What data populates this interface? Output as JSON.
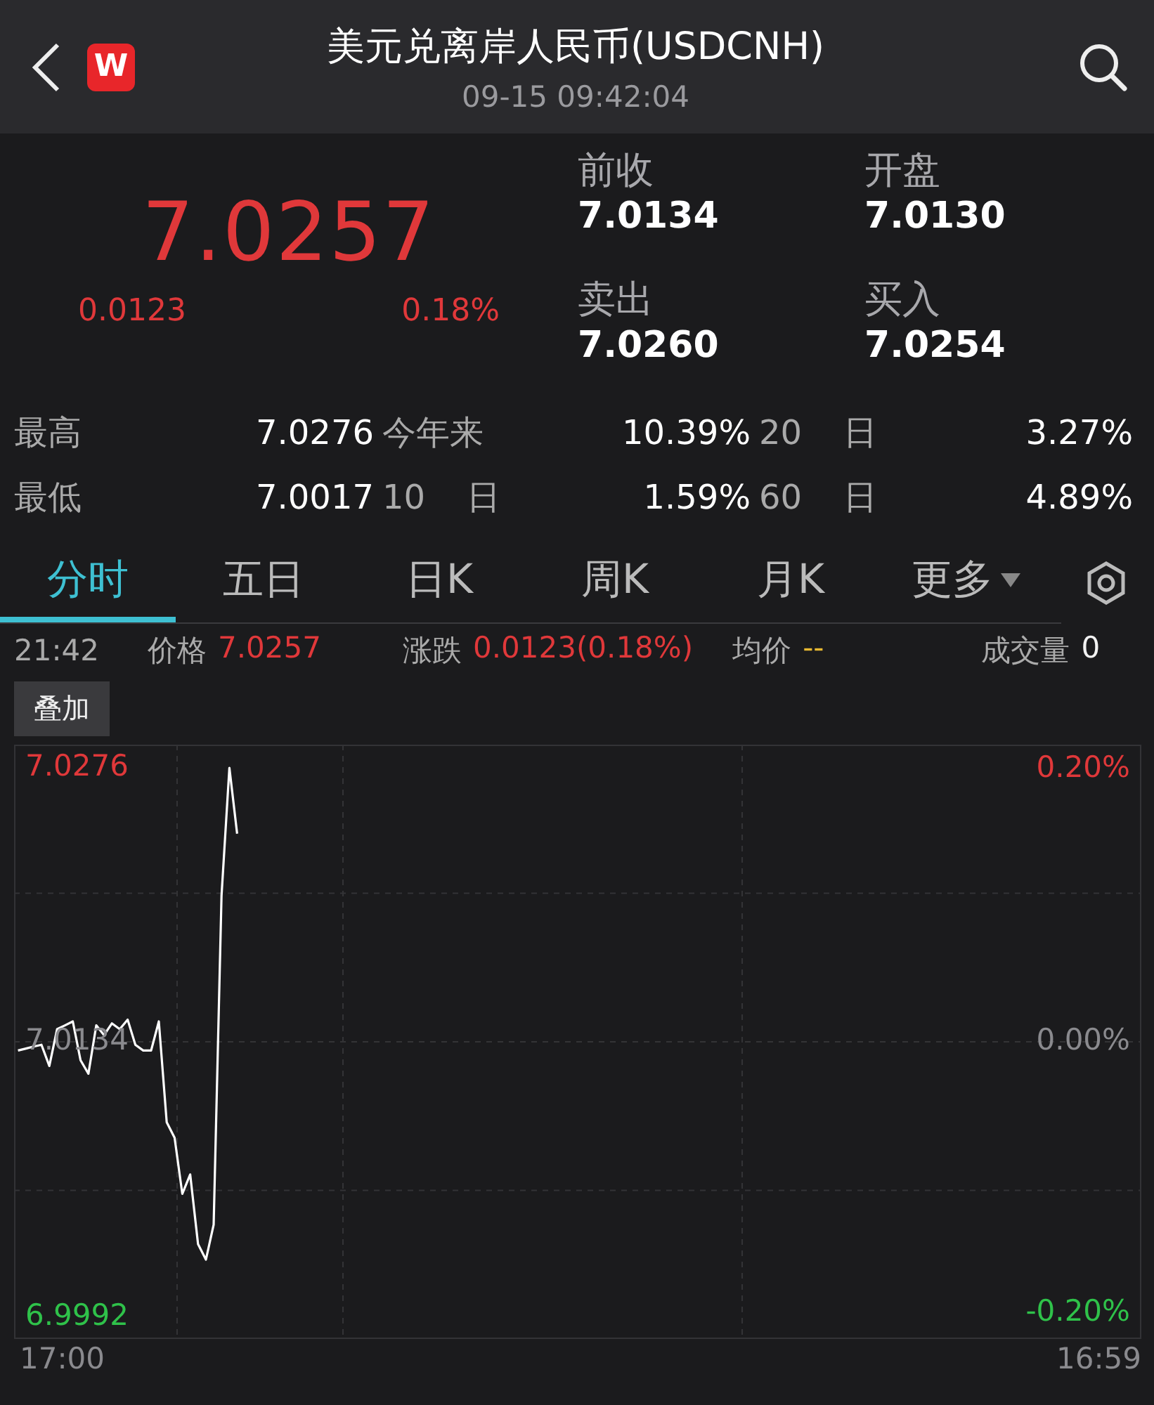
{
  "header": {
    "logo": "W",
    "title": "美元兑离岸人民币(USDCNH)",
    "time": "09-15 09:42:04"
  },
  "quote": {
    "price": "7.0257",
    "change": "0.0123",
    "change_pct": "0.18%",
    "color": "#e0383a",
    "fields": [
      {
        "label": "前收",
        "value": "7.0134"
      },
      {
        "label": "开盘",
        "value": "7.0130"
      },
      {
        "label": "卖出",
        "value": "7.0260"
      },
      {
        "label": "买入",
        "value": "7.0254"
      }
    ]
  },
  "stats": [
    [
      {
        "label": "最高",
        "value": "7.0276"
      },
      {
        "label": "今年来",
        "value": "10.39%"
      },
      {
        "label": "20 日",
        "value": "3.27%"
      }
    ],
    [
      {
        "label": "最低",
        "value": "7.0017"
      },
      {
        "label": "10 日",
        "value": "1.59%"
      },
      {
        "label": "60 日",
        "value": "4.89%"
      }
    ]
  ],
  "tabs": [
    {
      "label": "分时",
      "selected": true,
      "dropdown": false
    },
    {
      "label": "五日",
      "selected": false,
      "dropdown": false
    },
    {
      "label": "日K",
      "selected": false,
      "dropdown": false
    },
    {
      "label": "周K",
      "selected": false,
      "dropdown": false
    },
    {
      "label": "月K",
      "selected": false,
      "dropdown": false
    },
    {
      "label": "更多",
      "selected": false,
      "dropdown": true
    }
  ],
  "info": {
    "time": "21:42",
    "items": [
      {
        "label": "价格",
        "value": "7.0257",
        "color": "#e0383a"
      },
      {
        "label": "涨跌",
        "value": "0.0123(0.18%)",
        "color": "#e0383a"
      },
      {
        "label": "均价",
        "value": "--",
        "color": "#e8b931"
      },
      {
        "label": "成交量",
        "value": "0",
        "color": "#f2f2f2"
      }
    ]
  },
  "overlay_button": "叠加",
  "percent_axis": [
    "0.20%",
    "0.00%",
    "-0.20%"
  ],
  "time_axis": [
    "17:00",
    "16:59"
  ],
  "chart_data": {
    "type": "line",
    "ylim": [
      6.9981,
      7.0288
    ],
    "yticks": [
      {
        "value": 7.0276,
        "label": "7.0276"
      },
      {
        "value": 7.0134,
        "label": "7.0134"
      },
      {
        "value": 6.9992,
        "label": "6.9992"
      }
    ],
    "categories": [
      null,
      null,
      null,
      null,
      null,
      null,
      null,
      null,
      null,
      null,
      null,
      null,
      null,
      null,
      null,
      null,
      null,
      null,
      null,
      null,
      null,
      null,
      null,
      null,
      null,
      null,
      null,
      null,
      null,
      null,
      null,
      null,
      null,
      null,
      null,
      null,
      null,
      null,
      null,
      null,
      null,
      null,
      null,
      null,
      null,
      null,
      null,
      null,
      null,
      null,
      null,
      null,
      null,
      null,
      null,
      null,
      null,
      null,
      null,
      null,
      null,
      null,
      null,
      null,
      null,
      null,
      null,
      null,
      null,
      null,
      null,
      null,
      null,
      null,
      null,
      null,
      null,
      null,
      null,
      null,
      null,
      null,
      null,
      null,
      null,
      null,
      null,
      null,
      null,
      null,
      null,
      null,
      null,
      null,
      null,
      null,
      null,
      null,
      null,
      null,
      null,
      null,
      null,
      null,
      null,
      null,
      null,
      null,
      null,
      null,
      null,
      null,
      null,
      null,
      null,
      null,
      null,
      null,
      null,
      null,
      null,
      null,
      null,
      null,
      null,
      null,
      null,
      null,
      null,
      null,
      null,
      null,
      null,
      null,
      null,
      null,
      null,
      null,
      null,
      null,
      null,
      null,
      null,
      null
    ],
    "series": [
      {
        "color": "#ffffff",
        "values": [
          7.013,
          7.0131,
          7.0132,
          7.0133,
          7.0122,
          7.0141,
          7.0143,
          7.0145,
          7.0125,
          7.0118,
          7.0143,
          7.0138,
          7.0144,
          7.0141,
          7.0146,
          7.0133,
          7.013,
          7.013,
          7.0145,
          7.0093,
          7.0085,
          7.0056,
          7.0066,
          7.003,
          7.0022,
          7.004,
          7.021,
          7.0276,
          7.0242,
          null,
          null,
          null,
          null,
          null,
          null,
          null,
          null,
          null,
          null,
          null,
          null,
          null,
          null,
          null,
          null,
          null,
          null,
          null,
          null,
          null,
          null,
          null,
          null,
          null,
          null,
          null,
          null,
          null,
          null,
          null,
          null,
          null,
          null,
          null,
          null,
          null,
          null,
          null,
          null,
          null,
          null,
          null,
          null,
          null,
          null,
          null,
          null,
          null,
          null,
          null,
          null,
          null,
          null,
          null,
          null,
          null,
          null,
          null,
          null,
          null,
          null,
          null,
          null,
          null,
          null,
          null,
          null,
          null,
          null,
          null,
          null,
          null,
          null,
          null,
          null,
          null,
          null,
          null,
          null,
          null,
          null,
          null,
          null,
          null,
          null,
          null,
          null,
          null,
          null,
          null,
          null,
          null,
          null,
          null,
          null,
          null,
          null,
          null,
          null,
          null,
          null,
          null,
          null,
          null,
          null,
          null,
          null,
          null,
          null,
          null,
          null,
          null,
          null,
          null
        ]
      }
    ]
  }
}
